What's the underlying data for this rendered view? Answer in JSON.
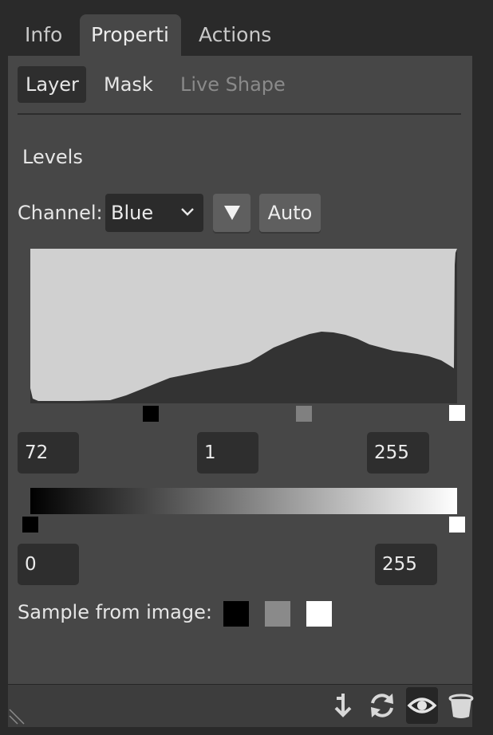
{
  "tabs": [
    {
      "label": "Info",
      "active": false
    },
    {
      "label": "Properti",
      "active": true
    },
    {
      "label": "Actions",
      "active": false
    }
  ],
  "subtabs": [
    {
      "label": "Layer",
      "active": true
    },
    {
      "label": "Mask",
      "active": false
    },
    {
      "label": "Live Shape",
      "active": false,
      "disabled": true
    }
  ],
  "section_title": "Levels",
  "channel": {
    "label": "Channel:",
    "value": "Blue"
  },
  "buttons": {
    "dropdown_icon": "triangle-down-icon",
    "auto_label": "Auto"
  },
  "input_levels": {
    "black": "72",
    "gamma": "1",
    "white": "255"
  },
  "output_levels": {
    "black": "0",
    "white": "255"
  },
  "sample": {
    "label": "Sample from image:"
  },
  "footer_icons": [
    "clip-to-layer-icon",
    "reset-icon",
    "visibility-icon",
    "trash-icon"
  ],
  "colors": {
    "panel_bg": "#474747",
    "histogram_bg": "#d0d0d0",
    "histogram_fill": "#333333",
    "gamma_swatch": "#808080"
  }
}
